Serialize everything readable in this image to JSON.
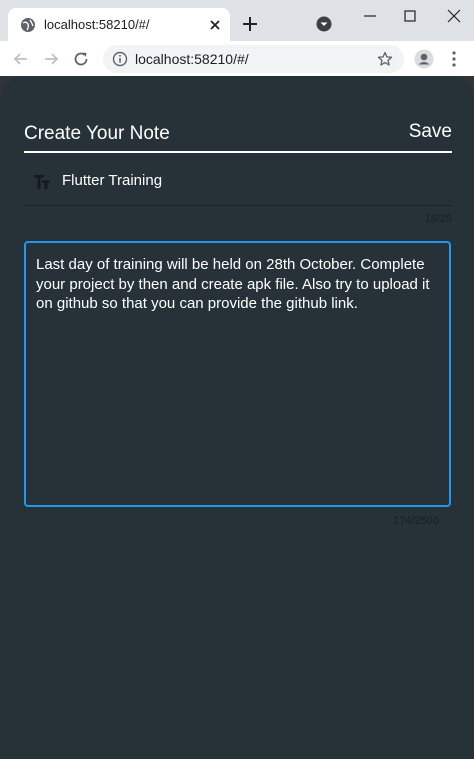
{
  "browser": {
    "tab_title": "localhost:58210/#/",
    "url": "localhost:58210/#/"
  },
  "icons": {
    "favicon": "globe-icon",
    "tab_close": "close-icon",
    "new_tab": "plus-icon",
    "tab_search": "tab-search-icon",
    "minimize": "minimize-icon",
    "maximize": "maximize-icon",
    "window_close": "close-icon",
    "back": "arrow-left-icon",
    "forward": "arrow-right-icon",
    "reload": "reload-icon",
    "site_info": "info-icon",
    "bookmark": "star-icon",
    "profile": "account-icon",
    "menu": "kebab-menu-icon",
    "title_field": "text-fields-icon"
  },
  "colors": {
    "background": "#263238",
    "focus_border": "#2196f3",
    "text": "#ffffff"
  },
  "note": {
    "header_title": "Create Your Note",
    "save_label": "Save",
    "title_value": "Flutter Training",
    "title_counter": "16/25",
    "body_value": "Last day of training will be held on 28th October. Complete your project by then and create apk file. Also try to upload it on github so that you can provide the github link.",
    "body_counter": "174/2500"
  }
}
